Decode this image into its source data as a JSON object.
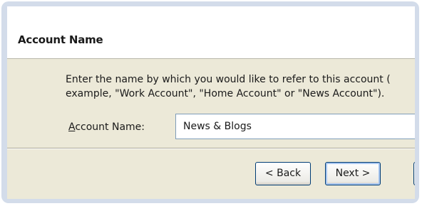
{
  "header": {
    "title": "Account Name"
  },
  "instructions": {
    "text": "Enter the name by which you would like to refer to this account (\nexample, \"Work Account\", \"Home Account\" or \"News Account\")."
  },
  "form": {
    "account_name_label_access_key": "A",
    "account_name_label_rest": "ccount Name:",
    "account_name_value": "News & Blogs"
  },
  "buttons": {
    "back_label": "< Back",
    "next_label": "Next >"
  }
}
